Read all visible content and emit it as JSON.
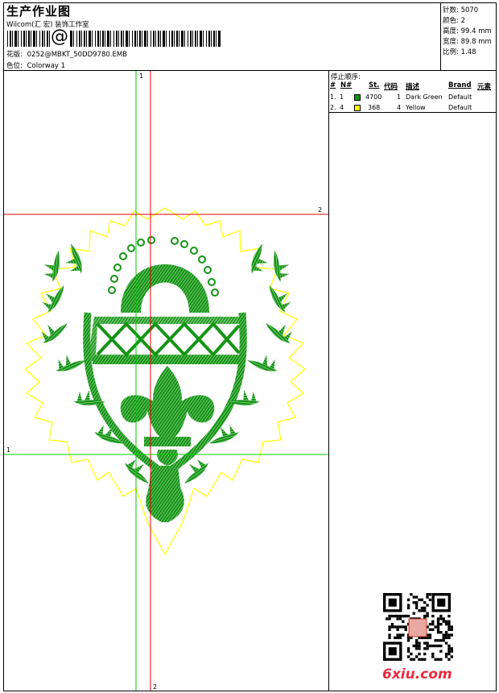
{
  "header": {
    "title": "生产作业图",
    "company": "Wilcom(汇 宏) 装饰工作室",
    "barcode_glyph": "@",
    "design_label": "花版:",
    "design_value": "0252@MBKT_50DD9780.EMB",
    "colorway_label": "色位:",
    "colorway_value": "Colorway 1"
  },
  "stats": {
    "stitches_label": "针数:",
    "stitches_value": "5070",
    "colors_label": "颜色:",
    "colors_value": "2",
    "height_label": "高度:",
    "height_value": "99.4 mm",
    "width_label": "宽度:",
    "width_value": "89.8 mm",
    "scale_label": "比例:",
    "scale_value": "1.48"
  },
  "stop_sequence": {
    "heading": "停止顺序:",
    "columns": [
      "#",
      "N#",
      "St.",
      "代码",
      "描述",
      "Brand",
      "元素"
    ],
    "rows": [
      {
        "seq": "1.",
        "n": "1",
        "color": "#149514",
        "stitches": "4700",
        "code": "1",
        "desc": "Dark Green",
        "brand": "Default"
      },
      {
        "seq": "2.",
        "n": "4",
        "color": "#ffff00",
        "stitches": "368",
        "code": "4",
        "desc": "Yellow",
        "brand": "Default"
      }
    ]
  },
  "guides": {
    "v_green": "1",
    "v_red": "2",
    "h_red": "2",
    "h_green": "1"
  },
  "colors": {
    "green": "#149514",
    "yellow": "#ffff00",
    "guide_red": "#dd0000",
    "guide_green": "#00cc00"
  },
  "watermark": "6xiu.com"
}
